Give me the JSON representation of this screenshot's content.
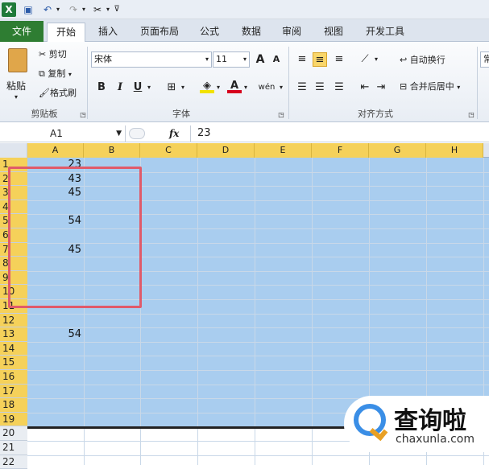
{
  "qat": {
    "excel_icon": "excel-logo-icon",
    "save": "save-icon",
    "undo": "undo-icon",
    "redo": "redo-icon",
    "tools": "format-painter-icon",
    "more": "customize-qat-icon"
  },
  "tabs": [
    "文件",
    "开始",
    "插入",
    "页面布局",
    "公式",
    "数据",
    "审阅",
    "视图",
    "开发工具"
  ],
  "ribbon": {
    "clipboard": {
      "paste": "粘贴",
      "cut": "剪切",
      "copy": "复制",
      "format_painter": "格式刷",
      "label": "剪贴板"
    },
    "font": {
      "name": "宋体",
      "size": "11",
      "grow": "A",
      "shrink": "A",
      "bold": "B",
      "italic": "I",
      "underline": "U",
      "phonetic": "wén",
      "label": "字体"
    },
    "align": {
      "wrap": "自动换行",
      "merge": "合并后居中",
      "label": "对齐方式"
    },
    "number": {
      "label": "常"
    }
  },
  "formula_bar": {
    "name_box": "A1",
    "fx": "fx",
    "value": "23"
  },
  "columns": [
    "A",
    "B",
    "C",
    "D",
    "E",
    "F",
    "G",
    "H"
  ],
  "rows": [
    "1",
    "2",
    "3",
    "4",
    "5",
    "6",
    "7",
    "8",
    "9",
    "10",
    "11",
    "12",
    "13",
    "14",
    "15",
    "16",
    "17",
    "18",
    "19",
    "20",
    "21",
    "22"
  ],
  "cells": {
    "A1": "23",
    "A2": "43",
    "A3": "45",
    "A5": "54",
    "A7": "45",
    "A13": "54"
  },
  "colors": {
    "selection": "#a9cdef",
    "header_selected": "#f5d15a",
    "annotation": "#e05a6a",
    "file_tab": "#2e7d32"
  },
  "watermark": {
    "title": "查询啦",
    "url": "chaxunla.com"
  }
}
